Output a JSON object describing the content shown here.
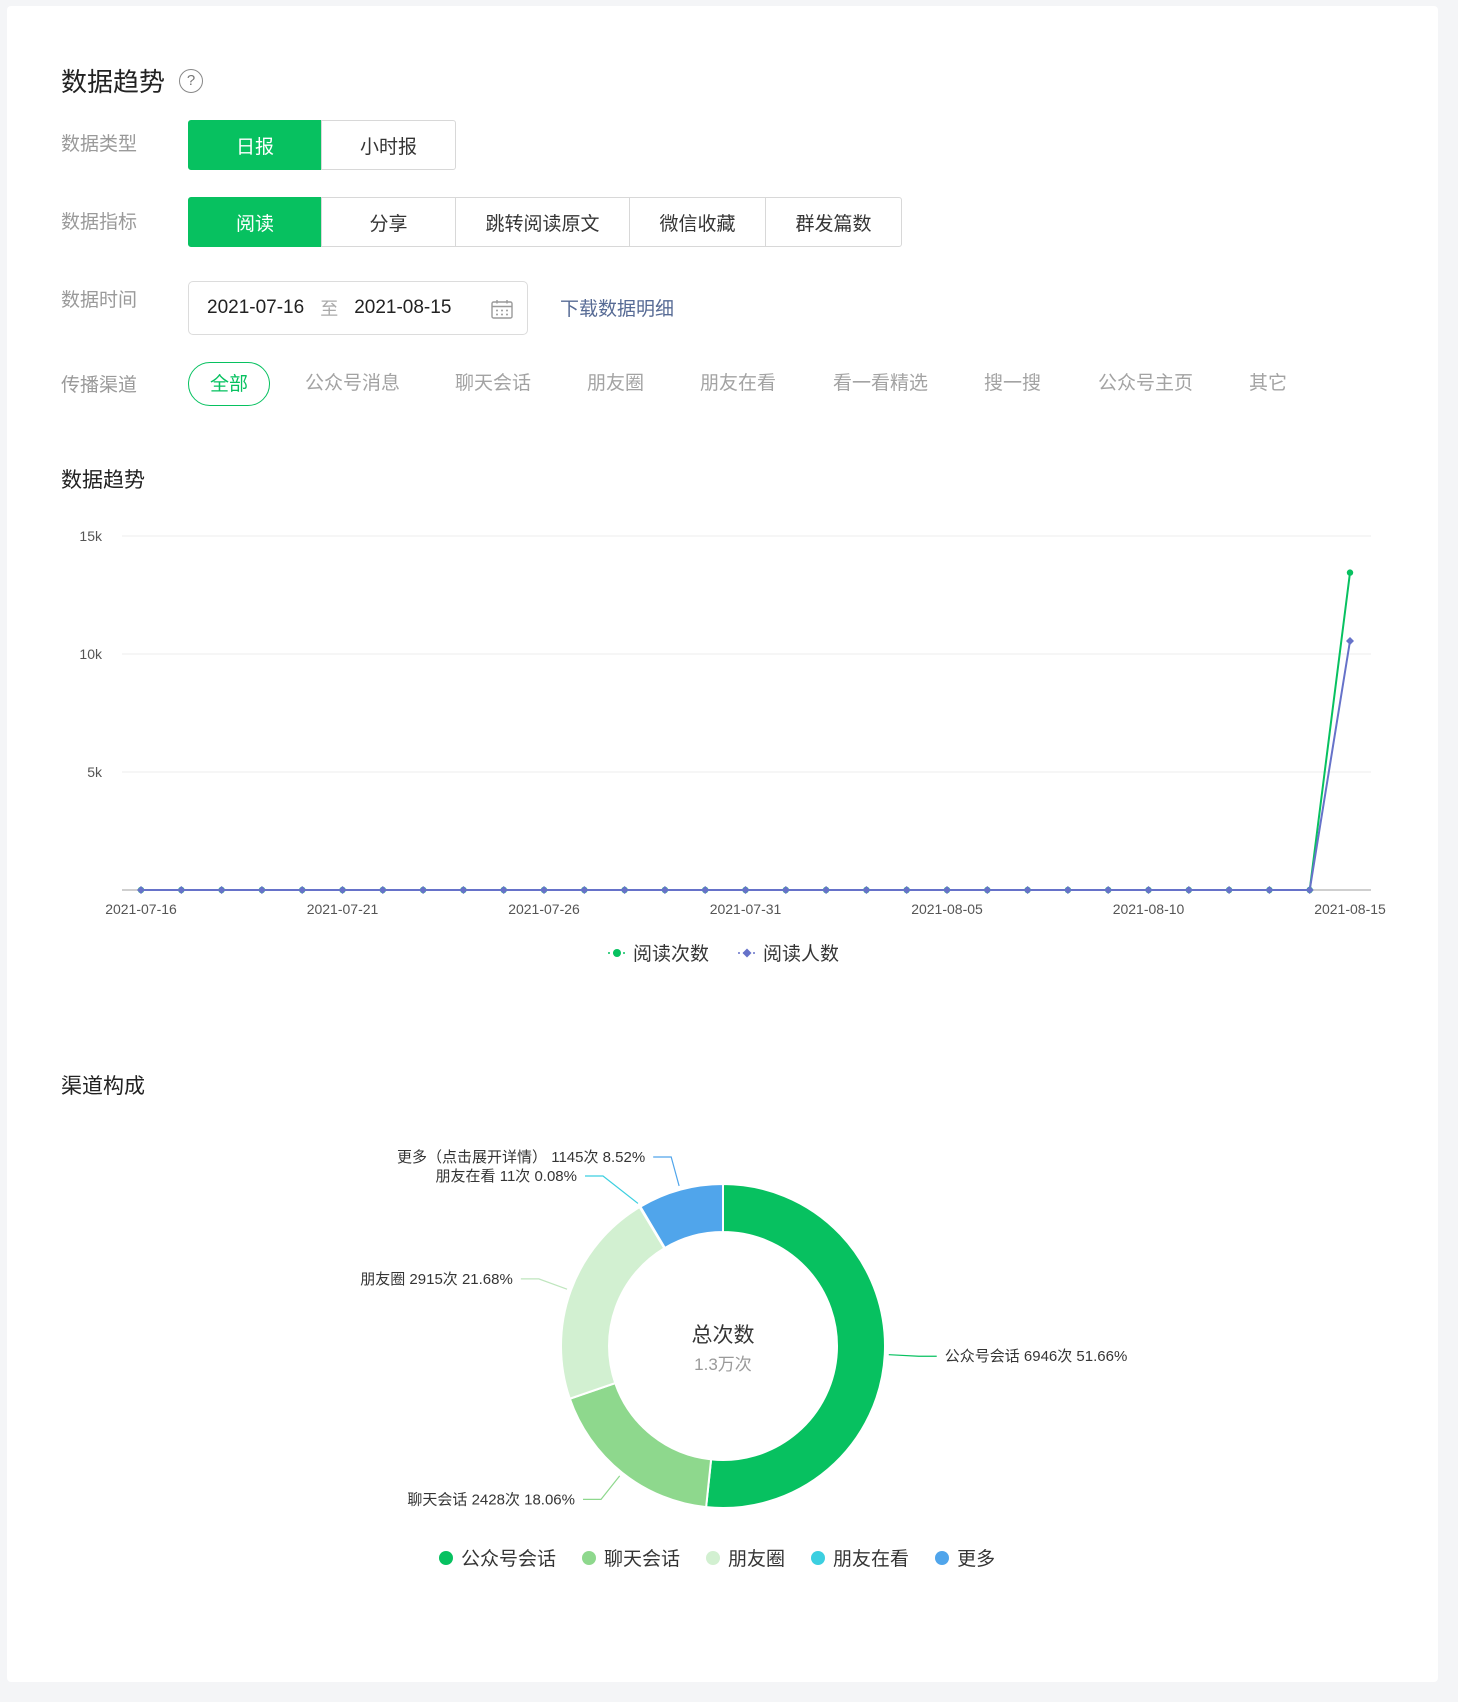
{
  "header": {
    "title": "数据趋势",
    "help_icon": "help-circle-icon"
  },
  "data_type": {
    "label": "数据类型",
    "options": [
      "日报",
      "小时报"
    ],
    "selected": "日报"
  },
  "metric": {
    "label": "数据指标",
    "options": [
      "阅读",
      "分享",
      "跳转阅读原文",
      "微信收藏",
      "群发篇数"
    ],
    "selected": "阅读"
  },
  "time": {
    "label": "数据时间",
    "start": "2021-07-16",
    "sep": "至",
    "end": "2021-08-15",
    "download": "下载数据明细"
  },
  "channel": {
    "label": "传播渠道",
    "options": [
      "全部",
      "公众号消息",
      "聊天会话",
      "朋友圈",
      "朋友在看",
      "看一看精选",
      "搜一搜",
      "公众号主页",
      "其它"
    ],
    "selected": "全部"
  },
  "trend_title": "数据趋势",
  "composition_title": "渠道构成",
  "colors": {
    "accent": "#07c160",
    "series2": "#6672c9",
    "link": "#576b95"
  },
  "chart_data": [
    {
      "type": "line",
      "x": [
        "2021-07-16",
        "2021-07-17",
        "2021-07-18",
        "2021-07-19",
        "2021-07-20",
        "2021-07-21",
        "2021-07-22",
        "2021-07-23",
        "2021-07-24",
        "2021-07-25",
        "2021-07-26",
        "2021-07-27",
        "2021-07-28",
        "2021-07-29",
        "2021-07-30",
        "2021-07-31",
        "2021-08-01",
        "2021-08-02",
        "2021-08-03",
        "2021-08-04",
        "2021-08-05",
        "2021-08-06",
        "2021-08-07",
        "2021-08-08",
        "2021-08-09",
        "2021-08-10",
        "2021-08-11",
        "2021-08-12",
        "2021-08-13",
        "2021-08-14",
        "2021-08-15"
      ],
      "x_tick_labels": [
        "2021-07-16",
        "2021-07-21",
        "2021-07-26",
        "2021-07-31",
        "2021-08-05",
        "2021-08-10",
        "2021-08-15"
      ],
      "y_tick_labels": [
        "5k",
        "10k",
        "15k"
      ],
      "ylim": [
        0,
        15000
      ],
      "grid": true,
      "legend": "bottom",
      "series": [
        {
          "name": "阅读次数",
          "color": "#07c160",
          "values": [
            0,
            0,
            0,
            0,
            0,
            0,
            0,
            0,
            0,
            0,
            0,
            0,
            0,
            0,
            0,
            0,
            0,
            0,
            0,
            0,
            0,
            0,
            0,
            0,
            0,
            0,
            0,
            0,
            0,
            0,
            13450
          ]
        },
        {
          "name": "阅读人数",
          "color": "#6672c9",
          "values": [
            0,
            0,
            0,
            0,
            0,
            0,
            0,
            0,
            0,
            0,
            0,
            0,
            0,
            0,
            0,
            0,
            0,
            0,
            0,
            0,
            0,
            0,
            0,
            0,
            0,
            0,
            0,
            0,
            0,
            0,
            10550
          ]
        }
      ]
    },
    {
      "type": "pie",
      "center_title": "总次数",
      "center_value": "1.3万次",
      "legend": "bottom",
      "slices": [
        {
          "name": "公众号会话",
          "value": 6946,
          "percent": 51.66,
          "color": "#07c160",
          "label": "公众号会话 6946次 51.66%"
        },
        {
          "name": "聊天会话",
          "value": 2428,
          "percent": 18.06,
          "color": "#8ed88d",
          "label": "聊天会话 2428次 18.06%"
        },
        {
          "name": "朋友圈",
          "value": 2915,
          "percent": 21.68,
          "color": "#d2f0d1",
          "label": "朋友圈 2915次 21.68%"
        },
        {
          "name": "朋友在看",
          "value": 11,
          "percent": 0.08,
          "color": "#3ccfe0",
          "label": "朋友在看 11次 0.08%"
        },
        {
          "name": "更多（点击展开详情）",
          "value": 1145,
          "percent": 8.52,
          "color": "#50a5eb",
          "label": "更多（点击展开详情） 1145次 8.52%"
        }
      ],
      "legend_items": [
        {
          "name": "公众号会话",
          "color": "#07c160"
        },
        {
          "name": "聊天会话",
          "color": "#8ed88d"
        },
        {
          "name": "朋友圈",
          "color": "#d2f0d1"
        },
        {
          "name": "朋友在看",
          "color": "#3ccfe0"
        },
        {
          "name": "更多",
          "color": "#50a5eb"
        }
      ]
    }
  ]
}
